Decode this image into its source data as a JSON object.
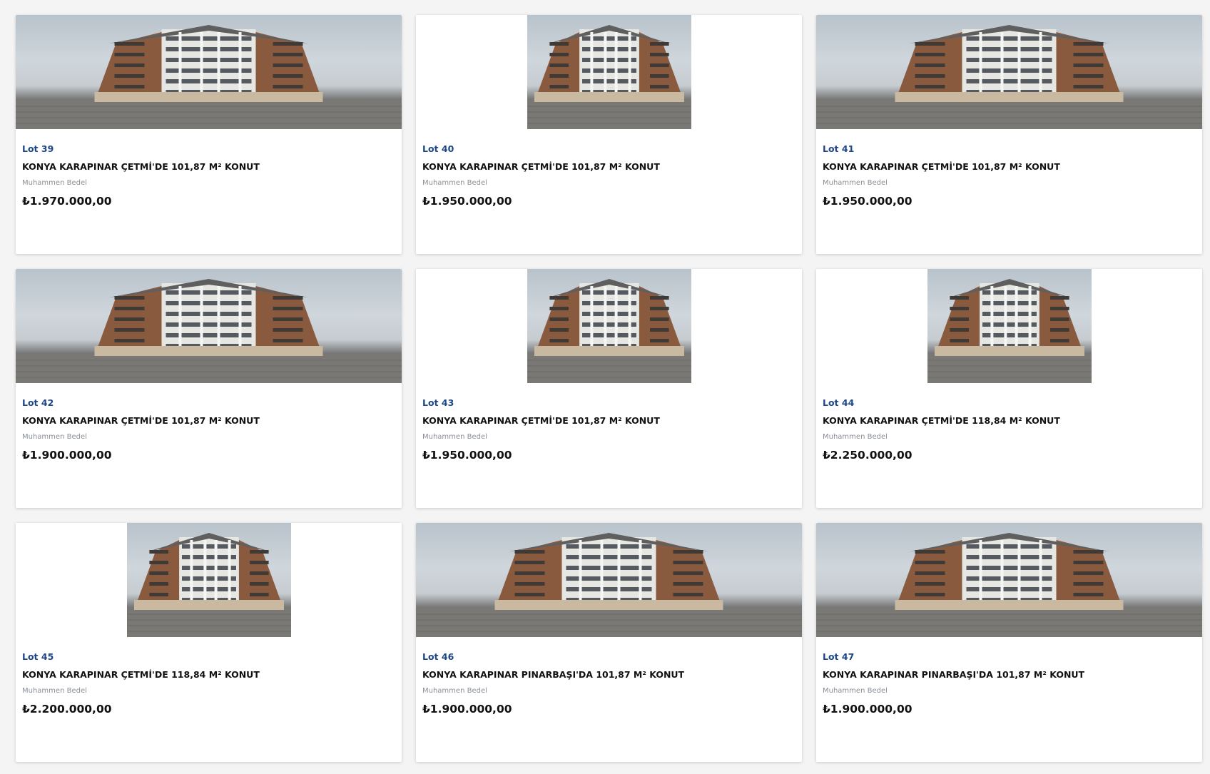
{
  "listing": {
    "price_label": "Muhammen Bedel",
    "cards": [
      {
        "lot": "Lot 39",
        "title": "KONYA KARAPINAR ÇETMİ'DE 101,87 M² KONUT",
        "price": "₺1.970.000,00",
        "photo": "wide"
      },
      {
        "lot": "Lot 40",
        "title": "KONYA KARAPINAR ÇETMİ'DE 101,87 M² KONUT",
        "price": "₺1.950.000,00",
        "photo": "narrow"
      },
      {
        "lot": "Lot 41",
        "title": "KONYA KARAPINAR ÇETMİ'DE 101,87 M² KONUT",
        "price": "₺1.950.000,00",
        "photo": "wide"
      },
      {
        "lot": "Lot 42",
        "title": "KONYA KARAPINAR ÇETMİ'DE 101,87 M² KONUT",
        "price": "₺1.900.000,00",
        "photo": "wide"
      },
      {
        "lot": "Lot 43",
        "title": "KONYA KARAPINAR ÇETMİ'DE 101,87 M² KONUT",
        "price": "₺1.950.000,00",
        "photo": "narrow"
      },
      {
        "lot": "Lot 44",
        "title": "KONYA KARAPINAR ÇETMİ'DE 118,84 M² KONUT",
        "price": "₺2.250.000,00",
        "photo": "narrow"
      },
      {
        "lot": "Lot 45",
        "title": "KONYA KARAPINAR ÇETMİ'DE 118,84 M² KONUT",
        "price": "₺2.200.000,00",
        "photo": "narrow"
      },
      {
        "lot": "Lot 46",
        "title": "KONYA KARAPINAR PINARBAŞI'DA 101,87 M² KONUT",
        "price": "₺1.900.000,00",
        "photo": "wide"
      },
      {
        "lot": "Lot 47",
        "title": "KONYA KARAPINAR PINARBAŞI'DA 101,87 M² KONUT",
        "price": "₺1.900.000,00",
        "photo": "wide"
      }
    ]
  }
}
